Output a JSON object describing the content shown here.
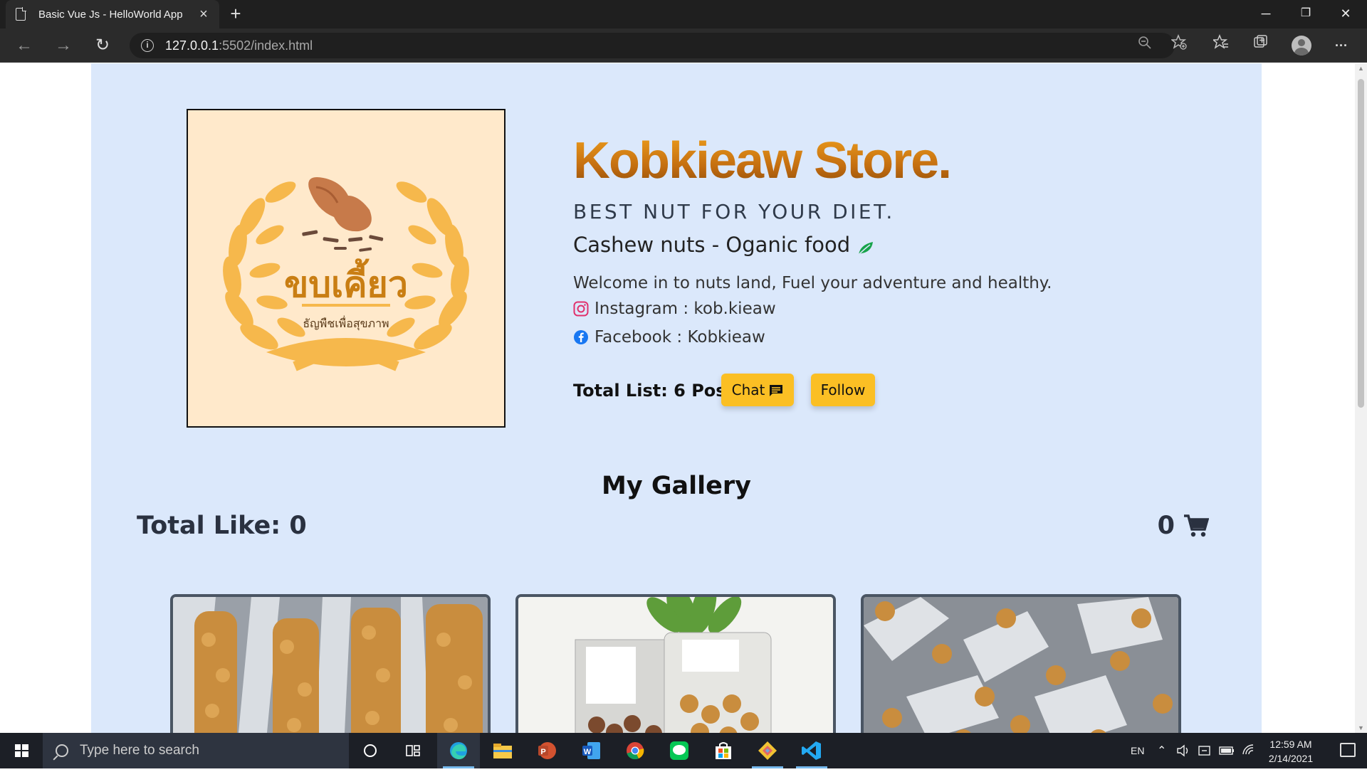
{
  "browser": {
    "tab_title": "Basic Vue Js - HelloWorld App",
    "tab_close": "×",
    "new_tab": "+",
    "url_host": "127.0.0.1",
    "url_path": ":5502/index.html",
    "minimize": "─",
    "restore": "❐",
    "close": "✕",
    "back": "←",
    "forward": "→",
    "reload": "↻",
    "more": "···"
  },
  "store": {
    "logo_text": "ขบเคี้ยว",
    "logo_subtext": "ธัญพืชเพื่อสุขภาพ",
    "title": "Kobkieaw Store.",
    "tagline": "BEST NUT FOR YOUR DIET.",
    "subtitle": "Cashew nuts - Oganic food",
    "welcome": "Welcome in to nuts land, Fuel your adventure and healthy.",
    "instagram": "Instagram : kob.kieaw",
    "facebook": "Facebook : Kobkieaw",
    "total_list": "Total List: 6 Posts.",
    "chat_label": "Chat",
    "follow_label": "Follow"
  },
  "gallery": {
    "title": "My Gallery",
    "total_like": "Total Like: 0",
    "cart_count": "0"
  },
  "colors": {
    "page_bg": "#dbe8fb",
    "accent_button": "#fbbf24",
    "brand_orange": "#c87a14",
    "logo_bg": "#ffe9cb"
  },
  "taskbar": {
    "search_placeholder": "Type here to search",
    "lang": "EN",
    "time": "12:59 AM",
    "date": "2/14/2021"
  }
}
